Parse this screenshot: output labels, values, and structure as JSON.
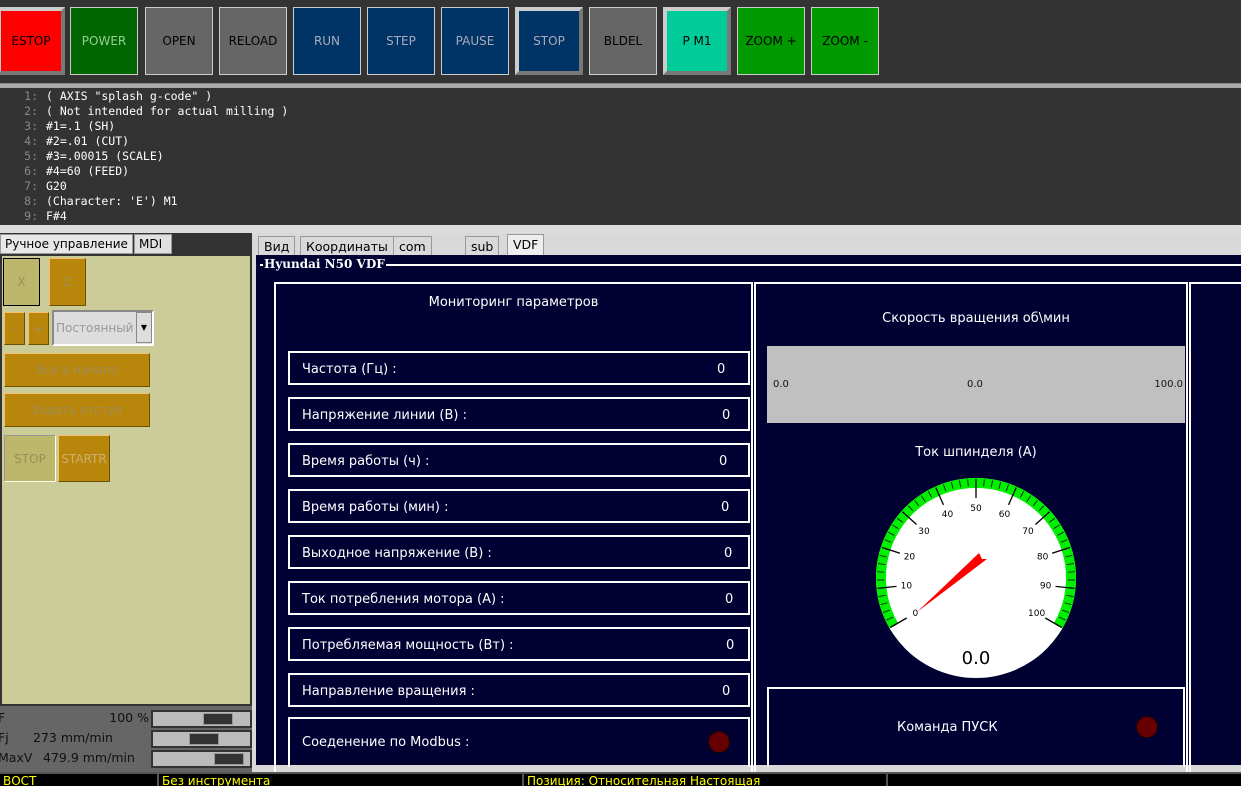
{
  "toolbar": {
    "buttons": [
      {
        "label": "ESTOP",
        "bg": "#ff0000",
        "fg": "#000"
      },
      {
        "label": "POWER",
        "bg": "#006600",
        "fg": "#9c9"
      },
      {
        "label": "OPEN",
        "bg": "#666666",
        "fg": "#000"
      },
      {
        "label": "RELOAD",
        "bg": "#666666",
        "fg": "#000"
      },
      {
        "label": "RUN",
        "bg": "#003366",
        "fg": "#aab"
      },
      {
        "label": "STEP",
        "bg": "#003366",
        "fg": "#aab"
      },
      {
        "label": "PAUSE",
        "bg": "#003366",
        "fg": "#aab"
      },
      {
        "label": "STOP",
        "bg": "#003366",
        "fg": "#aab"
      },
      {
        "label": "BLDEL",
        "bg": "#666666",
        "fg": "#000"
      },
      {
        "label": "P M1",
        "bg": "#00cc99",
        "fg": "#000"
      },
      {
        "label": "ZOOM +",
        "bg": "#009900",
        "fg": "#000"
      },
      {
        "label": "ZOOM -",
        "bg": "#009900",
        "fg": "#000"
      }
    ]
  },
  "code": {
    "lines": [
      {
        "n": "1:",
        "t": "( AXIS \"splash g-code\" )"
      },
      {
        "n": "2:",
        "t": "( Not intended for actual milling )"
      },
      {
        "n": "3:",
        "t": "#1=.1 (SH)"
      },
      {
        "n": "4:",
        "t": "#2=.01 (CUT)"
      },
      {
        "n": "5:",
        "t": "#3=.00015 (SCALE)"
      },
      {
        "n": "6:",
        "t": "#4=60 (FEED)"
      },
      {
        "n": "7:",
        "t": "G20"
      },
      {
        "n": "8:",
        "t": "(Character: 'E') M1"
      },
      {
        "n": "9:",
        "t": "F#4"
      }
    ]
  },
  "left": {
    "tabs": [
      "Ручное управление",
      "MDI"
    ],
    "axis_x": "X",
    "axis_z": "Z",
    "minus": "-",
    "plus": "+",
    "mode": "Постоянный",
    "home_all": "Все в начало",
    "touch_off": "Задать отступ",
    "stop": "STOP",
    "start": "STARTR"
  },
  "overrides": [
    {
      "label": "F",
      "value": "100 %",
      "level": 0.75
    },
    {
      "label": "Fj",
      "value": "273 mm/min",
      "level": 0.55
    },
    {
      "label": "MaxV",
      "value": "479.9 mm/min",
      "level": 0.92
    }
  ],
  "status": [
    "ВОСТ",
    "Без инструмента",
    "Позиция: Относительная Настоящая"
  ],
  "right": {
    "tabs": [
      "Вид",
      "Координаты",
      "com",
      "sub",
      "VDF"
    ],
    "active_tab": "VDF",
    "frame_title": "Hyundai N50 VDF",
    "monitor_title": "Мониторинг параметров",
    "rows": [
      {
        "label": "Частота (Гц) :",
        "value": "0"
      },
      {
        "label": "Напряжение линии (В) :",
        "value": "0"
      },
      {
        "label": "Время работы (ч) :",
        "value": "0"
      },
      {
        "label": "Время работы (мин) :",
        "value": "0"
      },
      {
        "label": "Выходное напряжение (В) :",
        "value": "0"
      },
      {
        "label": "Ток потребления мотора (А) :",
        "value": "0"
      },
      {
        "label": "Потребляемая мощность (Вт) :",
        "value": "0"
      },
      {
        "label": "Направление вращения :",
        "value": "0"
      }
    ],
    "modbus_label": "Соеденение по Modbus :",
    "speed_title": "Скорость вращения об\\мин",
    "speed_bar": {
      "min": "0.0",
      "value": "0.0",
      "max": "100.0"
    },
    "current_title": "Ток шпинделя (А)",
    "gauge": {
      "min": 0,
      "max": 100,
      "value": 0,
      "display": "0.0",
      "ticks": [
        "0",
        "10",
        "20",
        "30",
        "40",
        "50",
        "60",
        "70",
        "80",
        "90",
        "100"
      ],
      "ring_color": "#00ee00",
      "needle_color": "#ff0000"
    },
    "start_cmd": "Команда ПУСК",
    "led_color": "#660000"
  }
}
